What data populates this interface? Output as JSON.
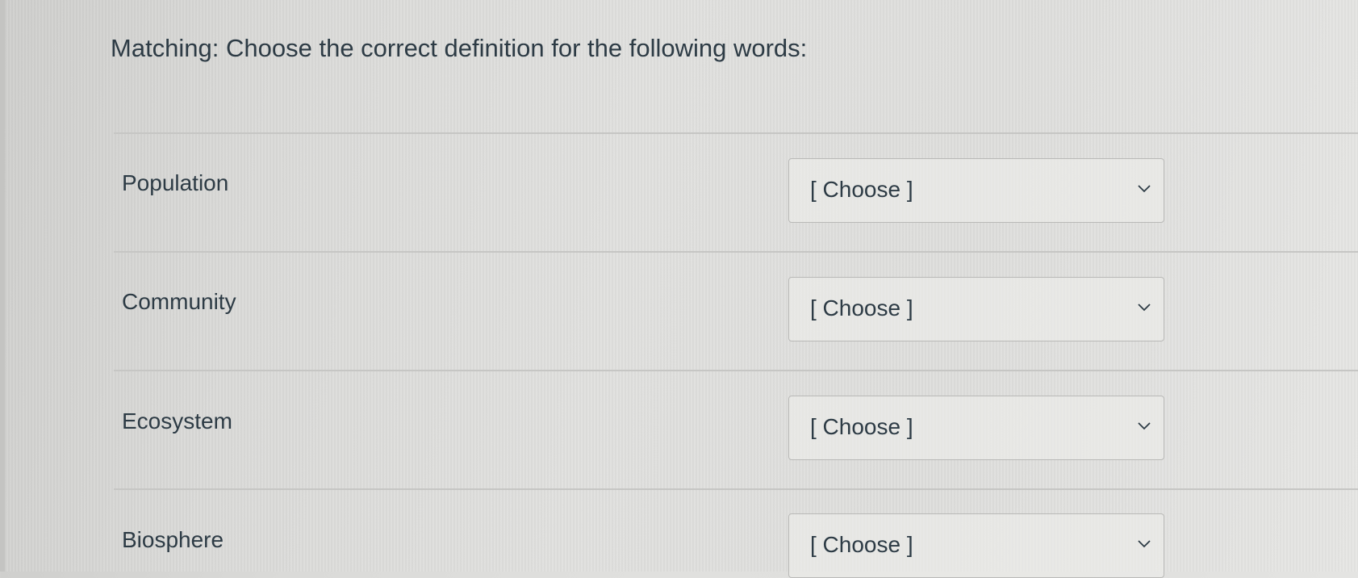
{
  "question": {
    "title": "Matching: Choose the correct definition for the following words:"
  },
  "rows": [
    {
      "term": "Population",
      "selected": "[ Choose ]",
      "icon": "chevron-down-icon"
    },
    {
      "term": "Community",
      "selected": "[ Choose ]",
      "icon": "chevron-down-icon"
    },
    {
      "term": "Ecosystem",
      "selected": "[ Choose ]",
      "icon": "chevron-down-icon"
    },
    {
      "term": "Biosphere",
      "selected": "[ Choose ]",
      "icon": "chevron-down-icon"
    }
  ]
}
